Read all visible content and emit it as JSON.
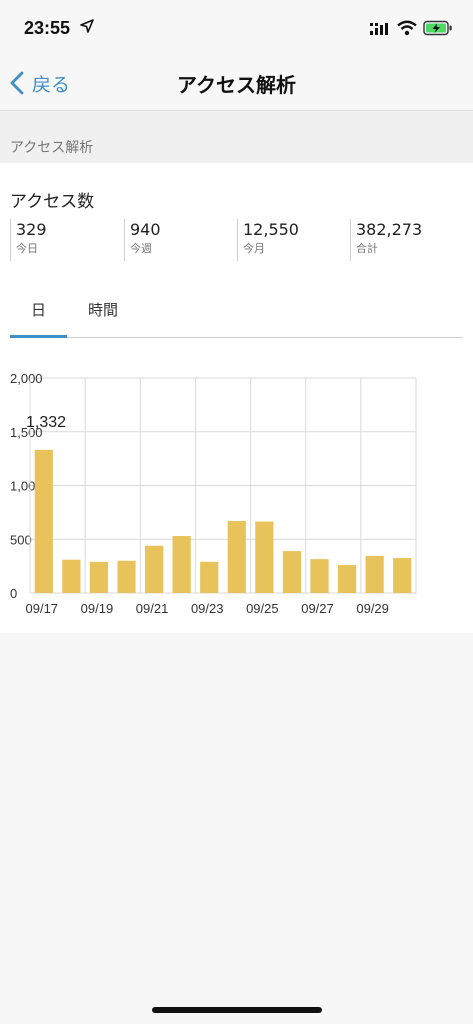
{
  "status_bar": {
    "time": "23:55"
  },
  "nav": {
    "back_label": "戻る",
    "title": "アクセス解析"
  },
  "section": {
    "header": "アクセス解析"
  },
  "card": {
    "title": "アクセス数",
    "stats": [
      {
        "value": "329",
        "label": "今日"
      },
      {
        "value": "940",
        "label": "今週"
      },
      {
        "value": "12,550",
        "label": "今月"
      },
      {
        "value": "382,273",
        "label": "合計"
      }
    ]
  },
  "tabs": [
    {
      "label": "日",
      "selected": true
    },
    {
      "label": "時間",
      "selected": false
    }
  ],
  "colors": {
    "accent": "#3f8fc7",
    "bar": "#e8c35c",
    "grid": "#d9d9d9"
  },
  "chart_data": {
    "type": "bar",
    "categories": [
      "09/17",
      "09/18",
      "09/19",
      "09/20",
      "09/21",
      "09/22",
      "09/23",
      "09/24",
      "09/25",
      "09/26",
      "09/27",
      "09/28",
      "09/29",
      "09/30"
    ],
    "x_tick_labels": [
      "09/17",
      "09/19",
      "09/21",
      "09/23",
      "09/25",
      "09/27",
      "09/29"
    ],
    "values": [
      1332,
      310,
      290,
      300,
      440,
      530,
      290,
      670,
      665,
      390,
      315,
      260,
      345,
      325
    ],
    "ylim": [
      0,
      2000
    ],
    "y_ticks": [
      "0",
      "500",
      "1,000",
      "1,500",
      "2,000"
    ],
    "annotation": "1,332",
    "grid": true
  }
}
